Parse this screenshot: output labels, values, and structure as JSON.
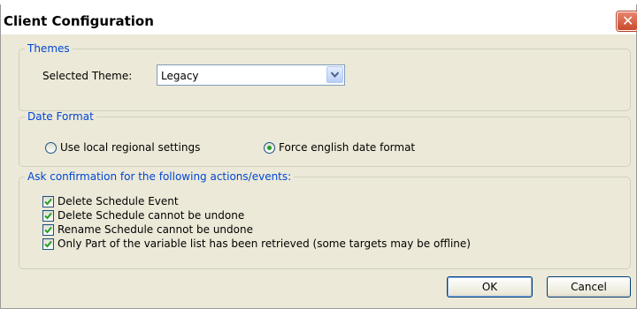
{
  "window": {
    "title": "Client Configuration"
  },
  "themes": {
    "group_title": "Themes",
    "label": "Selected Theme:",
    "selected": "Legacy"
  },
  "date_format": {
    "group_title": "Date Format",
    "options": [
      {
        "label": "Use local regional settings",
        "selected": false
      },
      {
        "label": "Force english date format",
        "selected": true
      }
    ]
  },
  "confirmations": {
    "group_title": "Ask confirmation for the following actions/events:",
    "items": [
      {
        "label": "Delete Schedule Event",
        "checked": true
      },
      {
        "label": "Delete Schedule cannot be undone",
        "checked": true
      },
      {
        "label": "Rename Schedule cannot be undone",
        "checked": true
      },
      {
        "label": "Only Part of the variable list has been retrieved (some targets may be offline)",
        "checked": true
      }
    ]
  },
  "buttons": {
    "ok": "OK",
    "cancel": "Cancel"
  },
  "colors": {
    "accent": "#0046d5",
    "check": "#21a121",
    "dialog_bg": "#ece9d8"
  },
  "icons": {
    "close": "close-icon",
    "dropdown": "chevron-down-icon",
    "check": "check-icon"
  }
}
